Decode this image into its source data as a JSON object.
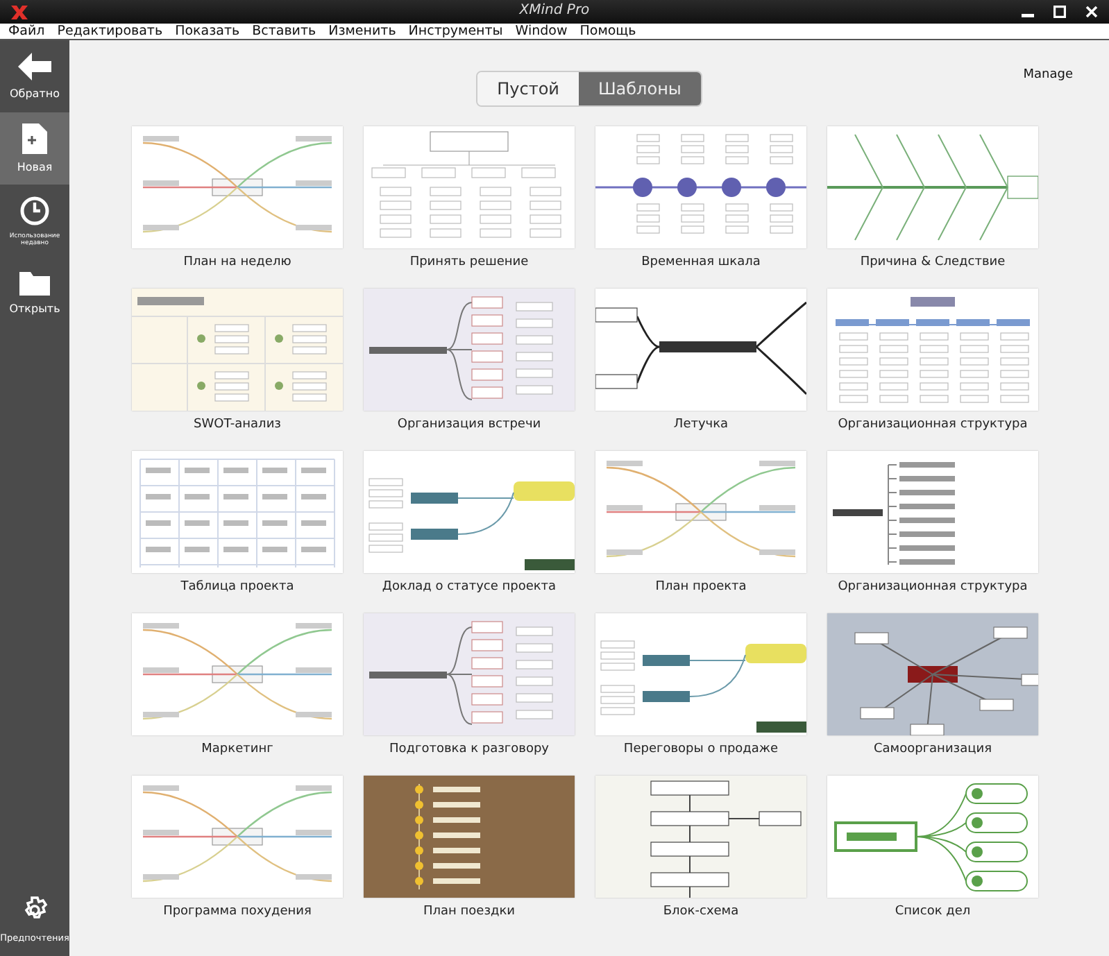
{
  "window": {
    "title": "XMind Pro"
  },
  "menu": [
    "Файл",
    "Редактировать",
    "Показать",
    "Вставить",
    "Изменить",
    "Инструменты",
    "Window",
    "Помощь"
  ],
  "sidebar": {
    "items": [
      {
        "label": "Обратно",
        "selected": false
      },
      {
        "label": "Новая",
        "selected": true
      },
      {
        "label": "Использование недавно",
        "selected": false
      },
      {
        "label": "Открыть",
        "selected": false
      }
    ],
    "footer": {
      "label": "Предпочтения"
    }
  },
  "segments": [
    {
      "label": "Пустой",
      "selected": false
    },
    {
      "label": "Шаблоны",
      "selected": true
    }
  ],
  "manage": "Manage",
  "templates": [
    {
      "label": "План на неделю",
      "kind": "mindmap"
    },
    {
      "label": "Принять решение",
      "kind": "tree"
    },
    {
      "label": "Временная шкала",
      "kind": "timeline"
    },
    {
      "label": "Причина & Следствие",
      "kind": "fishbone"
    },
    {
      "label": "SWOT-анализ",
      "kind": "swot"
    },
    {
      "label": "Организация встречи",
      "kind": "logic"
    },
    {
      "label": "Летучка",
      "kind": "meeting"
    },
    {
      "label": "Организационная структура",
      "kind": "org"
    },
    {
      "label": "Таблица проекта",
      "kind": "table"
    },
    {
      "label": "Доклад о статусе проекта",
      "kind": "status"
    },
    {
      "label": "План проекта",
      "kind": "mindmap"
    },
    {
      "label": "Организационная структура",
      "kind": "orglist"
    },
    {
      "label": "Маркетинг",
      "kind": "mindmap"
    },
    {
      "label": "Подготовка к разговору",
      "kind": "logic"
    },
    {
      "label": "Переговоры о продаже",
      "kind": "status"
    },
    {
      "label": "Самоорганизация",
      "kind": "concept"
    },
    {
      "label": "Программа похудения",
      "kind": "mindmap"
    },
    {
      "label": "План поездки",
      "kind": "wood"
    },
    {
      "label": "Блок-схема",
      "kind": "flow"
    },
    {
      "label": "Список дел",
      "kind": "todo"
    }
  ]
}
